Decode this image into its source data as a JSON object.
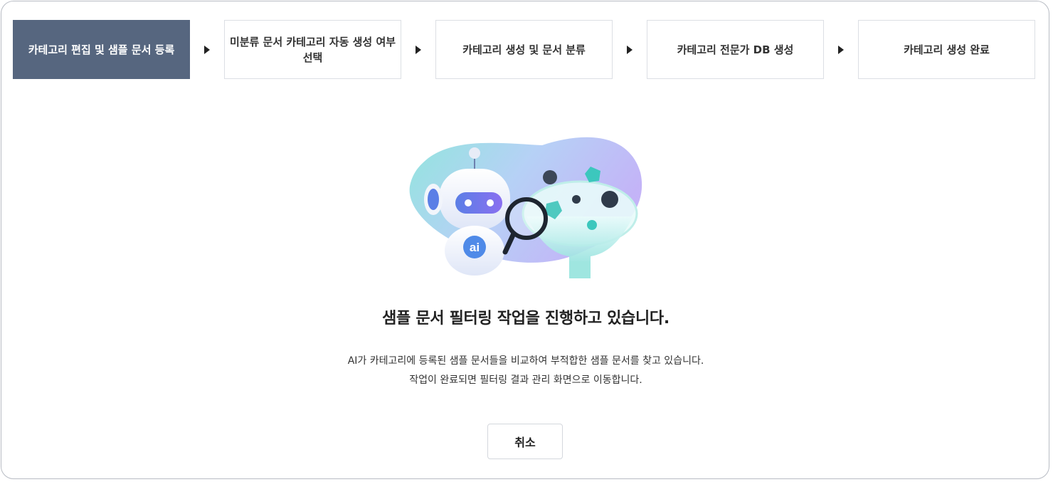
{
  "steps": [
    {
      "label": "카테고리 편집 및 샘플 문서 등록",
      "active": true
    },
    {
      "label": "미분류 문서 카테고리 자동 생성 여부 선택",
      "active": false
    },
    {
      "label": "카테고리 생성 및 문서 분류",
      "active": false
    },
    {
      "label": "카테고리 전문가 DB 생성",
      "active": false
    },
    {
      "label": "카테고리 생성 완료",
      "active": false
    }
  ],
  "illustration": {
    "badge_text": "ai",
    "icons": [
      "robot-icon",
      "magnifier-icon",
      "funnel-icon"
    ]
  },
  "main": {
    "title": "샘플 문서 필터링 작업을 진행하고 있습니다.",
    "description_line1": "AI가 카테고리에 등록된 샘플 문서들을 비교하여 부적합한 샘플 문서를 찾고 있습니다.",
    "description_line2": "작업이 완료되면 필터링 결과 관리 화면으로 이동합니다."
  },
  "actions": {
    "cancel_label": "취소"
  },
  "colors": {
    "active_step": "#56667f",
    "accent_teal": "#4ec8c8",
    "accent_purple": "#8c7cf0"
  }
}
